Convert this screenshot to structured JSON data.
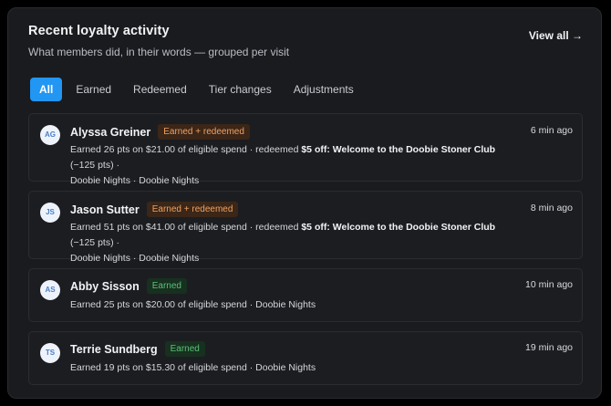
{
  "panel": {
    "title": "Recent loyalty activity",
    "subtitle": "What members did, in their words — grouped per visit",
    "view_all": "View all →"
  },
  "tabs": [
    {
      "label": "All",
      "active": true
    },
    {
      "label": "Earned",
      "active": false
    },
    {
      "label": "Redeemed",
      "active": false
    },
    {
      "label": "Tier changes",
      "active": false
    },
    {
      "label": "Adjustments",
      "active": false
    }
  ],
  "activities": [
    {
      "initials": "AG",
      "name": "Alyssa Greiner",
      "badge": "Earned + redeemed",
      "badge_color": "#f0a264",
      "time": "6 min ago",
      "earned_text": "Earned 26 pts on $21.00 of eligible spend · redeemed ",
      "reward": "$5 off: Welcome to the Doobie Stoner Club",
      "reward_cost": " (−125 pts) ·",
      "line2": "Doobie Nights · Doobie Nights"
    },
    {
      "initials": "JS",
      "name": "Jason Sutter",
      "badge": "Earned + redeemed",
      "badge_color": "#f0a264",
      "time": "8 min ago",
      "earned_text": "Earned 51 pts on $41.00 of eligible spend · redeemed ",
      "reward": "$5 off: Welcome to the Doobie Stoner Club",
      "reward_cost": " (−125 pts) ·",
      "line2": "Doobie Nights · Doobie Nights"
    },
    {
      "initials": "AS",
      "name": "Abby Sisson",
      "badge": "Earned",
      "badge_color": "#5cc07a",
      "time": "10 min ago",
      "earned_text": "Earned 25 pts on $20.00 of eligible spend · Doobie Nights"
    },
    {
      "initials": "TS",
      "name": "Terrie Sundberg",
      "badge": "Earned",
      "badge_color": "#5cc07a",
      "time": "19 min ago",
      "earned_text": "Earned 19 pts on $15.30 of eligible spend · Doobie Nights"
    }
  ],
  "colors": {
    "accent": "#2196f3",
    "panel_bg": "#1a1b1e"
  }
}
